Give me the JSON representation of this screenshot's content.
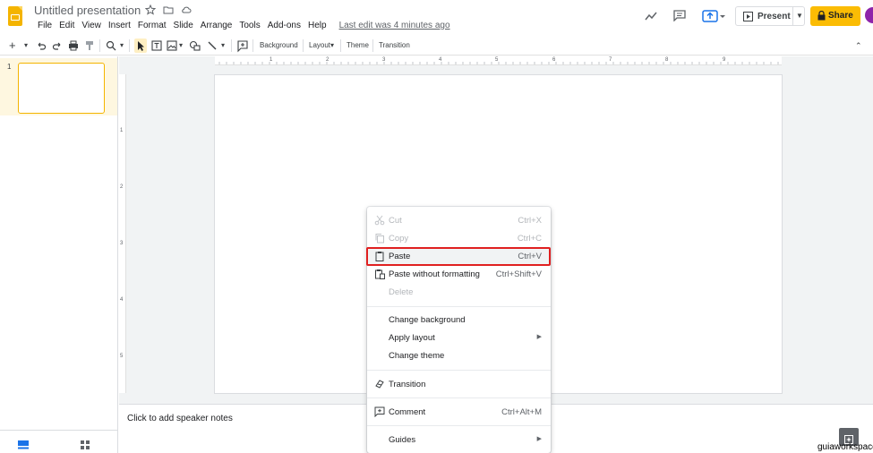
{
  "header": {
    "title": "Untitled presentation",
    "menu": [
      "File",
      "Edit",
      "View",
      "Insert",
      "Format",
      "Slide",
      "Arrange",
      "Tools",
      "Add-ons",
      "Help"
    ],
    "last_edit": "Last edit was 4 minutes ago",
    "present_label": "Present",
    "share_label": "Share",
    "brand_color": "#f4b400",
    "share_color": "#fbbc04"
  },
  "toolbar": {
    "background": "Background",
    "layout": "Layout",
    "theme": "Theme",
    "transition": "Transition"
  },
  "filmstrip": {
    "slide_number": "1"
  },
  "ruler": {
    "top": [
      "1",
      "2",
      "3",
      "4",
      "5",
      "6",
      "7",
      "8",
      "9"
    ],
    "left": [
      "1",
      "2",
      "3",
      "4",
      "5"
    ]
  },
  "notes": {
    "placeholder": "Click to add speaker notes"
  },
  "context_menu": {
    "items": [
      {
        "label": "Cut",
        "shortcut": "Ctrl+X",
        "icon": "scissors-icon",
        "state": "disabled"
      },
      {
        "label": "Copy",
        "shortcut": "Ctrl+C",
        "icon": "copy-icon",
        "state": "disabled"
      },
      {
        "label": "Paste",
        "shortcut": "Ctrl+V",
        "icon": "clipboard-icon",
        "state": "highlighted"
      },
      {
        "label": "Paste without formatting",
        "shortcut": "Ctrl+Shift+V",
        "icon": "clipboard-plain-icon",
        "state": "normal"
      },
      {
        "label": "Delete",
        "shortcut": "",
        "icon": "",
        "state": "disabled"
      },
      {
        "label": "Change background",
        "shortcut": "",
        "icon": "",
        "state": "normal"
      },
      {
        "label": "Apply layout",
        "shortcut": "",
        "icon": "",
        "state": "normal",
        "submenu": true
      },
      {
        "label": "Change theme",
        "shortcut": "",
        "icon": "",
        "state": "normal"
      },
      {
        "label": "Transition",
        "shortcut": "",
        "icon": "transition-icon",
        "state": "normal"
      },
      {
        "label": "Comment",
        "shortcut": "Ctrl+Alt+M",
        "icon": "comment-icon",
        "state": "normal"
      },
      {
        "label": "Guides",
        "shortcut": "",
        "icon": "",
        "state": "normal",
        "submenu": true
      }
    ],
    "highlight_color": "#e02020"
  },
  "watermark": "guiaworkspace"
}
